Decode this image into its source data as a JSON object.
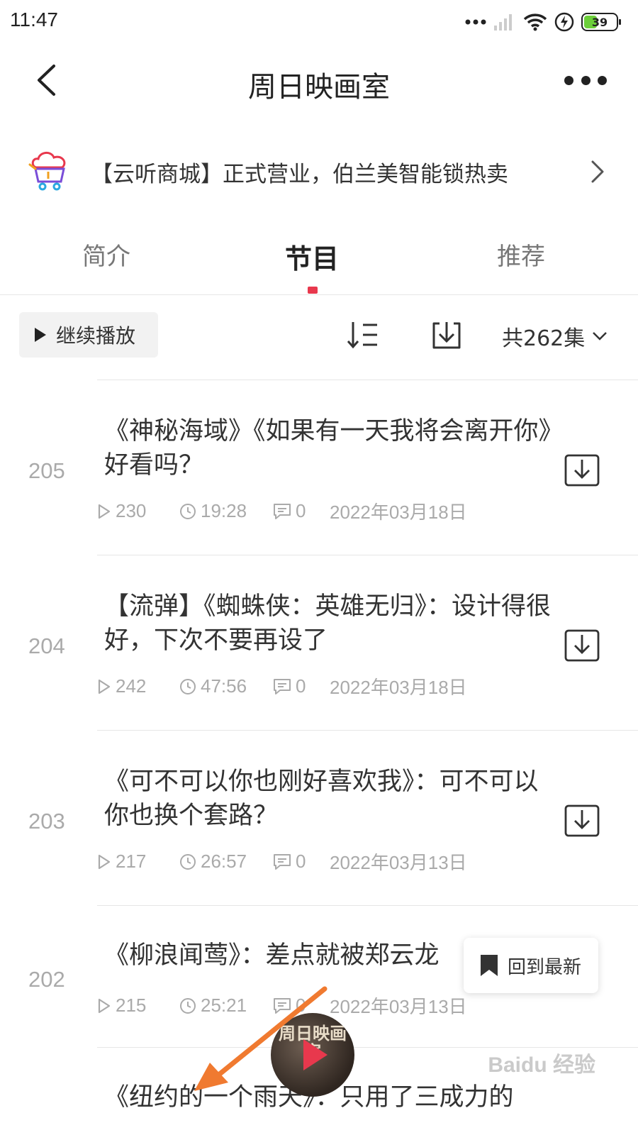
{
  "status_bar": {
    "time": "11:47",
    "battery": "39"
  },
  "nav": {
    "title": "周日映画室"
  },
  "banner": {
    "text": "【云听商城】正式营业，伯兰美智能锁热卖"
  },
  "tabs": [
    {
      "label": "简介"
    },
    {
      "label": "节目"
    },
    {
      "label": "推荐"
    }
  ],
  "toolbar": {
    "continue_label": "继续播放",
    "count_label": "共262集"
  },
  "episodes": [
    {
      "number": "205",
      "title": "《神秘海域》《如果有一天我将会离开你》好看吗？",
      "plays": "230",
      "duration": "19:28",
      "comments": "0",
      "date": "2022年03月18日"
    },
    {
      "number": "204",
      "title": "【流弹】《蜘蛛侠：英雄无归》：设计得很好，下次不要再设了",
      "plays": "242",
      "duration": "47:56",
      "comments": "0",
      "date": "2022年03月18日"
    },
    {
      "number": "203",
      "title": "《可不可以你也刚好喜欢我》：可不可以你也换个套路？",
      "plays": "217",
      "duration": "26:57",
      "comments": "0",
      "date": "2022年03月13日"
    },
    {
      "number": "202",
      "title": "《柳浪闻莺》：差点就被郑云龙",
      "plays": "215",
      "duration": "25:21",
      "comments": "0",
      "date": "2022年03月13日"
    },
    {
      "title": "《纽约的一个雨天》：只用了三成力的"
    }
  ],
  "float_button": {
    "label": "回到最新"
  },
  "mini_player": {
    "cover_text": "周日映画室"
  },
  "watermark": {
    "text": "Baidu 经验"
  },
  "colors": {
    "accent": "#e8384d",
    "text": "#333333",
    "muted": "#aaaaaa"
  }
}
